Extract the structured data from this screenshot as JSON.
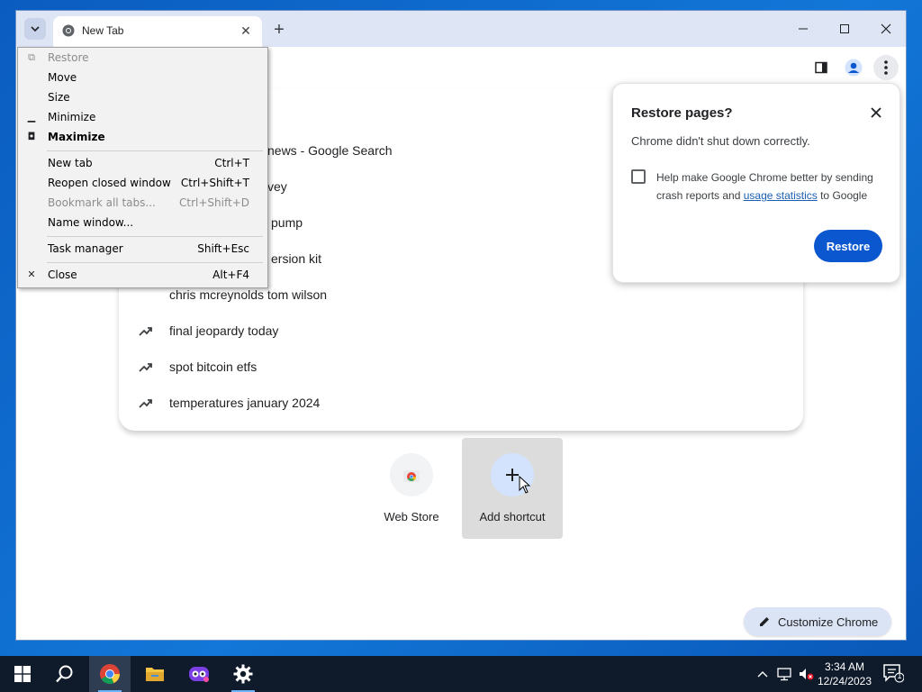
{
  "browser": {
    "tab": {
      "title": "New Tab"
    },
    "window_controls": {
      "minimize": "—",
      "maximize": "☐",
      "close": "✕"
    }
  },
  "system_menu": {
    "items": [
      {
        "label": "Restore",
        "glyph": "⧉",
        "shortcut": "",
        "disabled": true
      },
      {
        "label": "Move",
        "glyph": "",
        "shortcut": "",
        "disabled": false
      },
      {
        "label": "Size",
        "glyph": "",
        "shortcut": "",
        "disabled": false
      },
      {
        "label": "Minimize",
        "glyph": "▁",
        "shortcut": "",
        "disabled": false
      },
      {
        "label": "Maximize",
        "glyph": "◘",
        "shortcut": "",
        "disabled": false,
        "bold": true
      },
      {
        "label": "New tab",
        "glyph": "",
        "shortcut": "Ctrl+T",
        "disabled": false
      },
      {
        "label": "Reopen closed window",
        "glyph": "",
        "shortcut": "Ctrl+Shift+T",
        "disabled": false
      },
      {
        "label": "Bookmark all tabs...",
        "glyph": "",
        "shortcut": "Ctrl+Shift+D",
        "disabled": true
      },
      {
        "label": "Name window...",
        "glyph": "",
        "shortcut": "",
        "disabled": false
      },
      {
        "label": "Task manager",
        "glyph": "",
        "shortcut": "Shift+Esc",
        "disabled": false
      },
      {
        "label": "Close",
        "glyph": "✕",
        "shortcut": "Alt+F4",
        "disabled": false
      }
    ]
  },
  "suggestions": [
    {
      "text": "news - Google Search",
      "partial": true
    },
    {
      "text": "vey",
      "partial": true
    },
    {
      "text": "pump",
      "partial": true
    },
    {
      "text": "ersion kit",
      "partial": true
    },
    {
      "text": "chris mcreynolds tom wilson",
      "partial": true
    },
    {
      "text": "final jeopardy today",
      "partial": false
    },
    {
      "text": "spot bitcoin etfs",
      "partial": false
    },
    {
      "text": "temperatures january 2024",
      "partial": false
    }
  ],
  "shortcuts": [
    {
      "label": "Web Store",
      "icon": "chrome-webstore-icon"
    },
    {
      "label": "Add shortcut",
      "icon": "plus-icon"
    }
  ],
  "customize": {
    "label": "Customize Chrome"
  },
  "restore_bubble": {
    "title": "Restore pages?",
    "message": "Chrome didn't shut down correctly.",
    "help_prefix": "Help make Google Chrome better by sending crash reports and ",
    "help_link": "usage statistics",
    "help_suffix": " to Google",
    "checkbox_checked": false,
    "button": "Restore"
  },
  "taskbar": {
    "clock_time": "3:34 AM",
    "clock_date": "12/24/2023",
    "notification_count": "1"
  },
  "colors": {
    "accent": "#0b57d0",
    "titlebar": "#dee5f4",
    "taskbar": "#0f1b2a"
  }
}
